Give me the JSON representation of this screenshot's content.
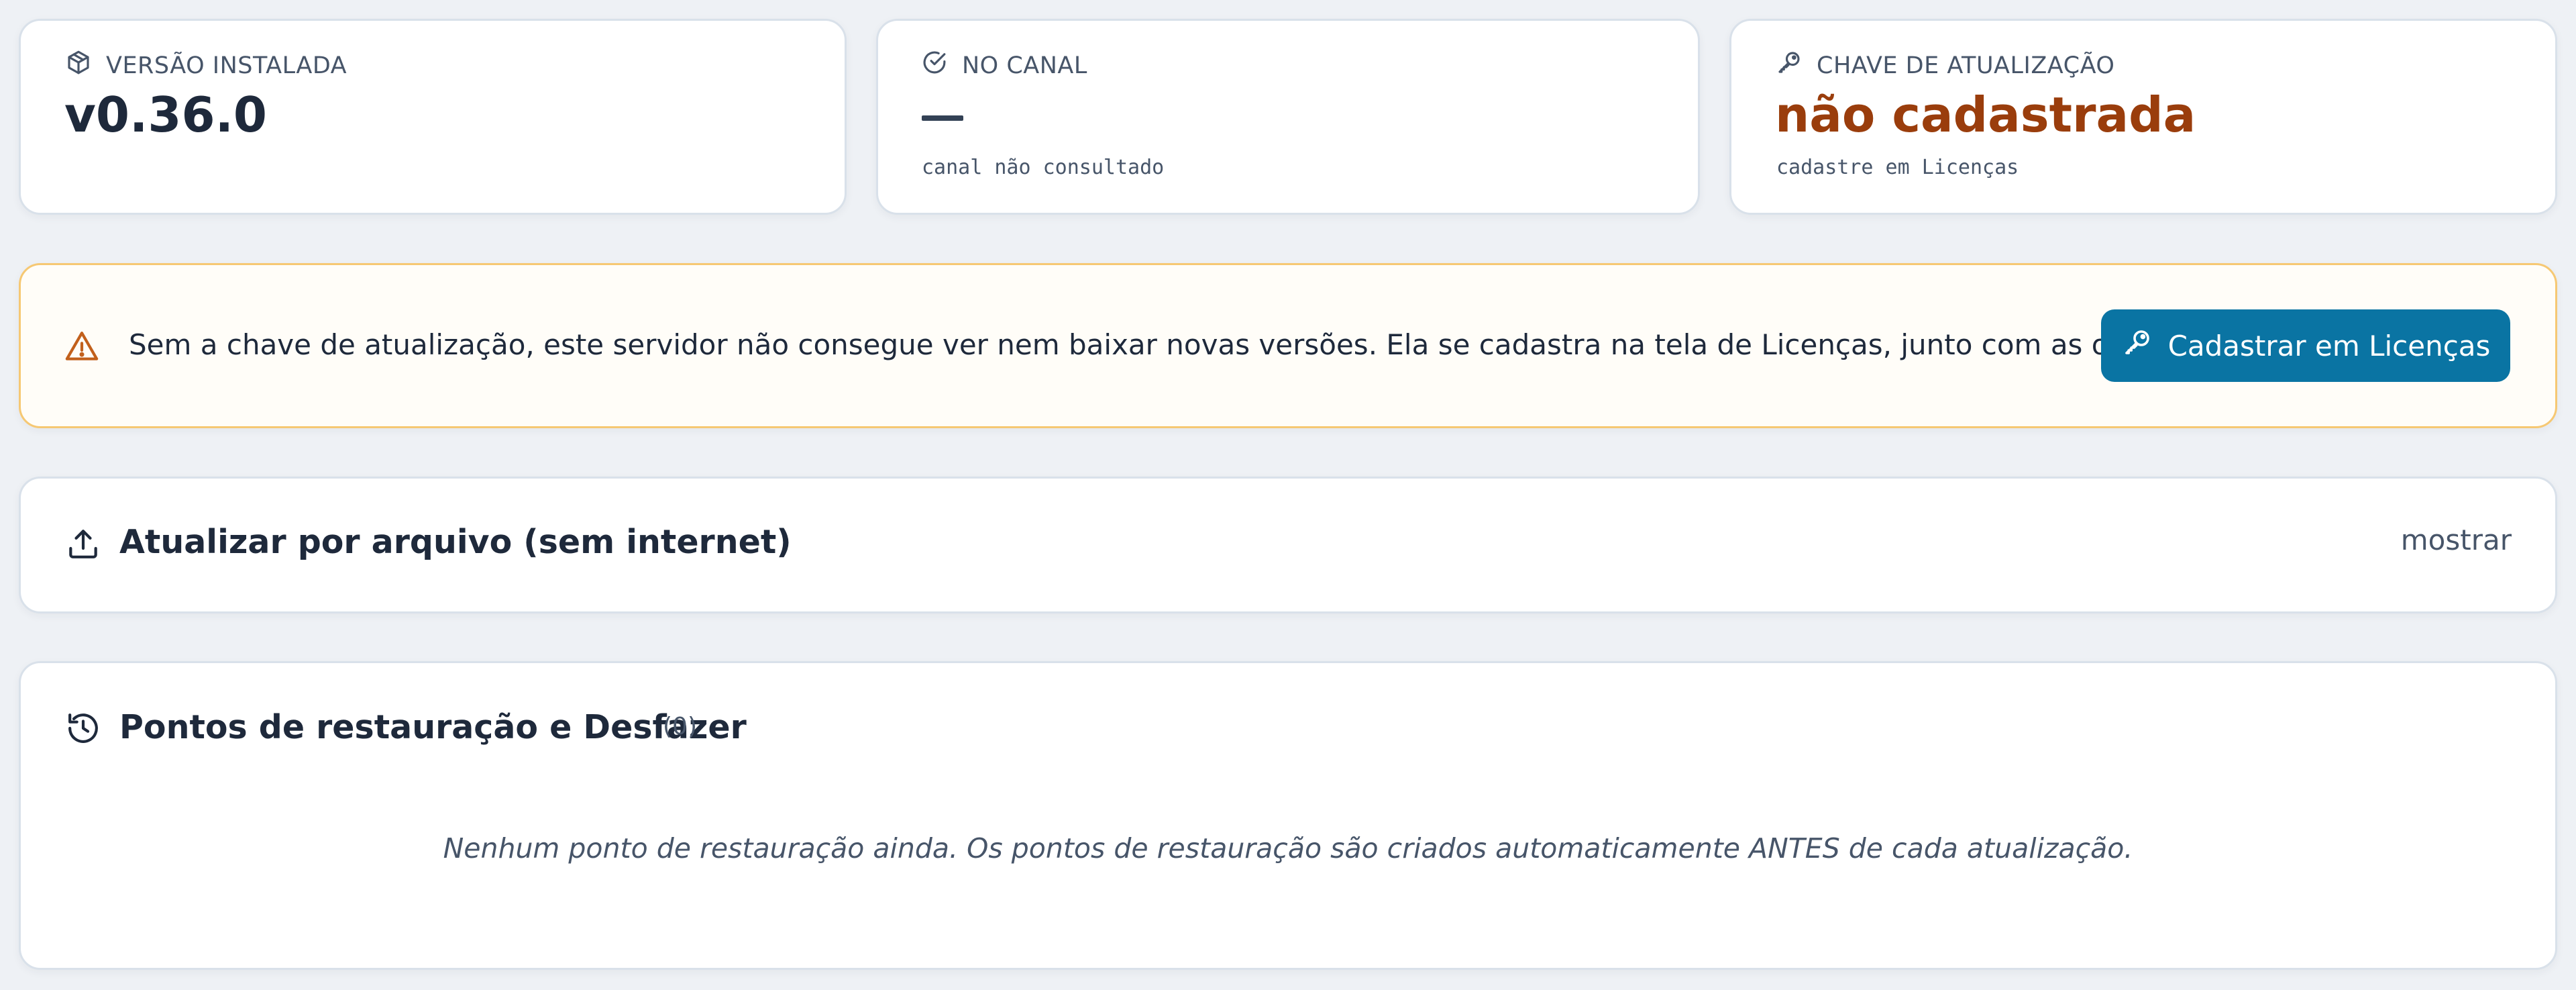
{
  "cards": {
    "installed": {
      "label": "VERSÃO INSTALADA",
      "value": "v0.36.0",
      "icon": "package-icon"
    },
    "channel": {
      "label": "NO CANAL",
      "value": "—",
      "sub": "canal não consultado",
      "icon": "check-circle-icon"
    },
    "key": {
      "label": "CHAVE DE ATUALIZAÇÃO",
      "value": "não cadastrada",
      "sub": "cadastre em Licenças",
      "icon": "key-icon"
    }
  },
  "banner": {
    "text": "Sem a chave de atualização, este servidor não consegue ver nem baixar novas versões. Ela se cadastra na tela de Licenças, junto com as outras.",
    "button_label": "Cadastrar em Licenças",
    "icon": "warning-icon"
  },
  "offline_update": {
    "title": "Atualizar por arquivo (sem internet)",
    "toggle_label": "mostrar",
    "icon": "upload-icon"
  },
  "restore_points": {
    "title": "Pontos de restauração e Desfazer",
    "count": "(0)",
    "empty_message": "Nenhum ponto de restauração ainda. Os pontos de restauração são criados automaticamente ANTES de cada atualização.",
    "icon": "history-icon"
  },
  "colors": {
    "accent": "#0a74a3",
    "warning_text": "#9a3d0c",
    "warning_border": "#f6c873",
    "warning_icon": "#c2601c"
  }
}
